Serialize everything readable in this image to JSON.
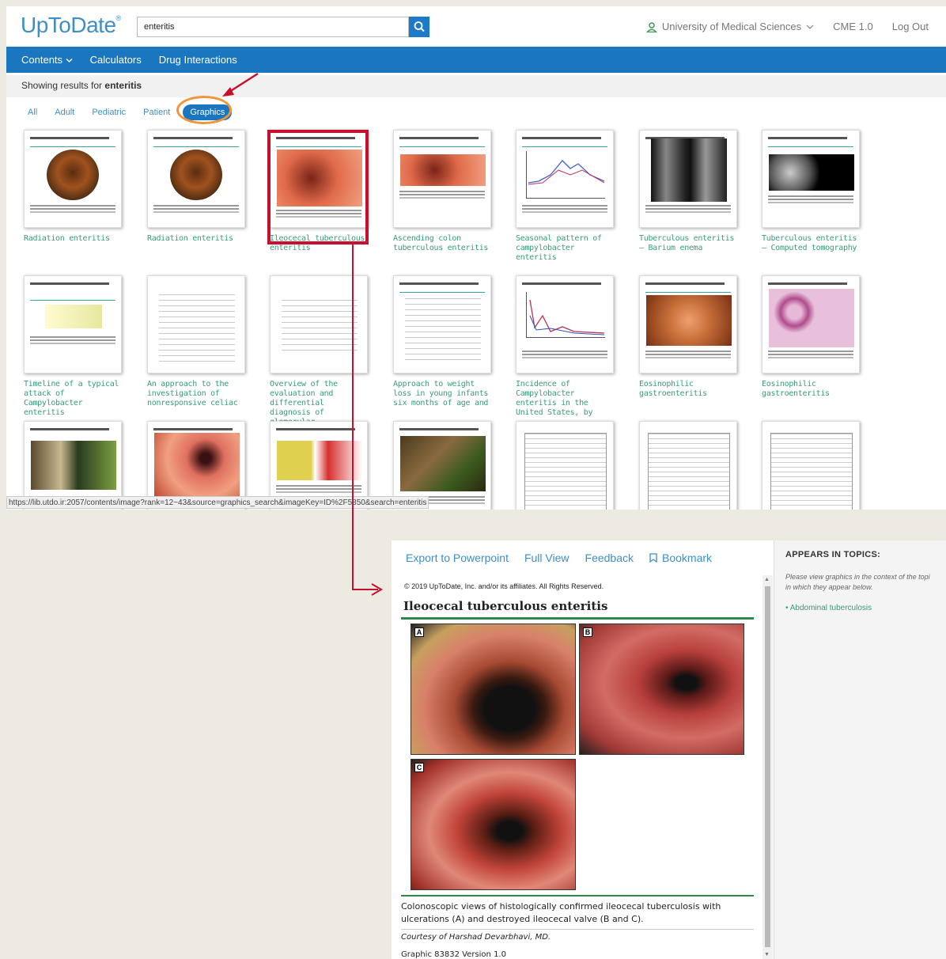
{
  "header": {
    "logo": "UpToDate",
    "logo_mark": "®",
    "search_value": "enteritis",
    "institution": "University of Medical Sciences",
    "cme": "CME 1.0",
    "logout": "Log Out"
  },
  "nav": {
    "contents": "Contents",
    "calculators": "Calculators",
    "drug_interactions": "Drug Interactions"
  },
  "results": {
    "prefix": "Showing results for",
    "term": "enteritis"
  },
  "filters": {
    "all": "All",
    "adult": "Adult",
    "pediatric": "Pediatric",
    "patient": "Patient",
    "graphics": "Graphics"
  },
  "tiles": [
    {
      "label": "Radiation enteritis"
    },
    {
      "label": "Radiation enteritis"
    },
    {
      "label": "Ileocecal tuberculous enteritis"
    },
    {
      "label": "Ascending colon tuberculous enteritis"
    },
    {
      "label": "Seasonal pattern of campylobacter enteritis"
    },
    {
      "label": "Tuberculous enteritis – Barium enema"
    },
    {
      "label": "Tuberculous enteritis – Computed tomography"
    },
    {
      "label": "Timeline of a typical attack of Campylobacter enteritis"
    },
    {
      "label": "An approach to the investigation of nonresponsive celiac"
    },
    {
      "label": "Overview of the evaluation and differential diagnosis of glomerular"
    },
    {
      "label": "Approach to weight loss in young infants six months of age and"
    },
    {
      "label": "Incidence of Campylobacter enteritis in the United States, by"
    },
    {
      "label": "Eosinophilic gastroenteritis"
    },
    {
      "label": "Eosinophilic gastroenteritis"
    }
  ],
  "status_url": "https://lib.utdo.ir:2057/contents/image?rank=12~43&source=graphics_search&imageKey=ID%2F5850&search=enteritis",
  "viewer": {
    "toolbar": {
      "export": "Export to Powerpoint",
      "full_view": "Full View",
      "feedback": "Feedback",
      "bookmark": "Bookmark"
    },
    "copyright": "© 2019 UpToDate, Inc. and/or its affiliates. All Rights Reserved.",
    "title": "Ileocecal tuberculous enteritis",
    "panels": {
      "a": "A",
      "b": "B",
      "c": "C"
    },
    "caption": "Colonoscopic views of histologically confirmed ileocecal tuberculosis with ulcerations (A) and destroyed ileocecal valve (B and C).",
    "courtesy": "Courtesy of Harshad Devarbhavi, MD.",
    "graphic_number": "Graphic 83832 Version 1.0"
  },
  "topics_panel": {
    "heading": "APPEARS IN TOPICS:",
    "note": "Please view graphics in the context of the topi\nin which they appear below.",
    "items": [
      "Abdominal tuberculosis"
    ]
  },
  "colors": {
    "brand_blue": "#1b76c0",
    "link_green": "#3a9a7a",
    "highlight_red": "#c8102e",
    "highlight_orange": "#f0953a"
  }
}
